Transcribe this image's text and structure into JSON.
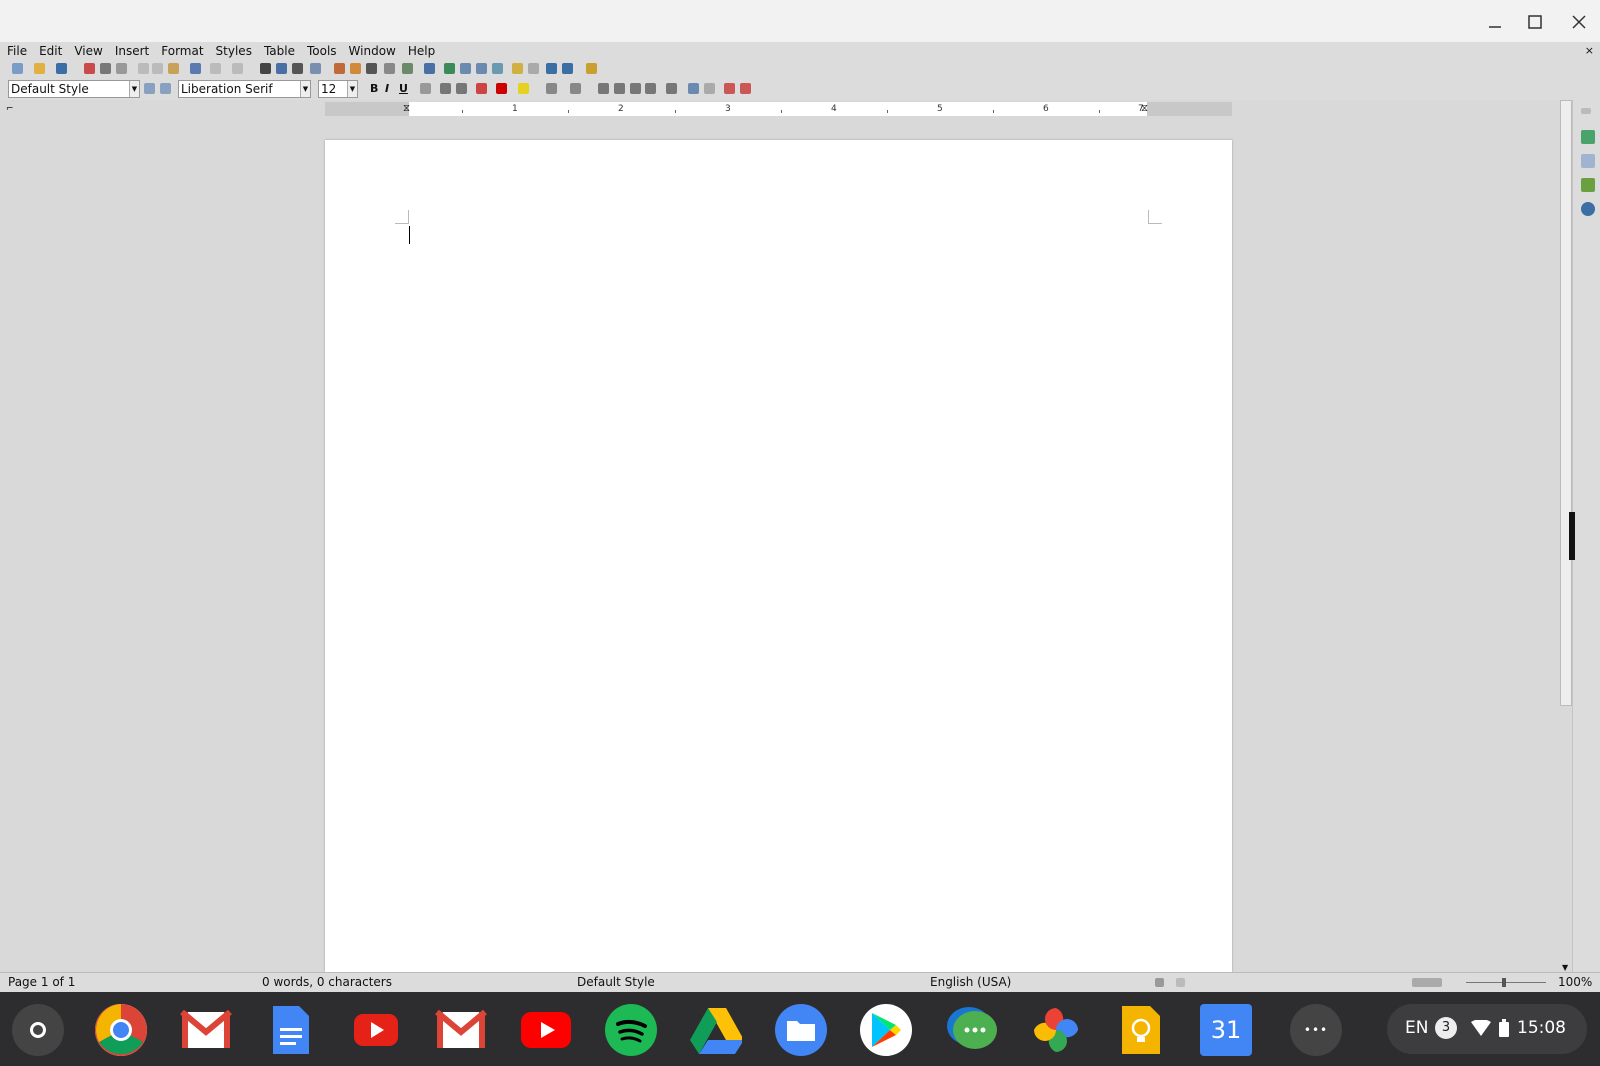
{
  "menubar": {
    "items": [
      "File",
      "Edit",
      "View",
      "Insert",
      "Format",
      "Styles",
      "Table",
      "Tools",
      "Window",
      "Help"
    ],
    "close_glyph": "×"
  },
  "toolbar2": {
    "paragraph_style": "Default Style",
    "font_name": "Liberation Serif",
    "font_size": "12",
    "bold": "B",
    "italic": "I",
    "underline": "U"
  },
  "ruler": {
    "labels": [
      "1",
      "2",
      "3",
      "4",
      "5",
      "6",
      "7"
    ]
  },
  "statusbar": {
    "page": "Page 1 of 1",
    "words": "0 words, 0 characters",
    "style": "Default Style",
    "language": "English (USA)",
    "zoom": "100%"
  },
  "shelf": {
    "apps": [
      {
        "name": "launcher-icon"
      },
      {
        "name": "chrome-icon"
      },
      {
        "name": "gmail-icon"
      },
      {
        "name": "google-docs-icon"
      },
      {
        "name": "youtube-icon"
      },
      {
        "name": "gmail-icon"
      },
      {
        "name": "youtube-icon"
      },
      {
        "name": "spotify-icon"
      },
      {
        "name": "google-drive-icon"
      },
      {
        "name": "files-icon"
      },
      {
        "name": "play-store-icon"
      },
      {
        "name": "messages-icon"
      },
      {
        "name": "google-photos-icon"
      },
      {
        "name": "keep-icon"
      },
      {
        "name": "calendar-icon"
      },
      {
        "name": "more-apps-icon"
      }
    ],
    "calendar_day": "31",
    "more_glyph": "•••"
  },
  "tray": {
    "language": "EN",
    "notifications": "3",
    "time": "15:08"
  },
  "colors": {
    "chrome_red": "#db4437",
    "docs_blue": "#4285f4",
    "spotify_green": "#1db954",
    "youtube_red": "#ff0000",
    "keep_yellow": "#f4b400"
  }
}
